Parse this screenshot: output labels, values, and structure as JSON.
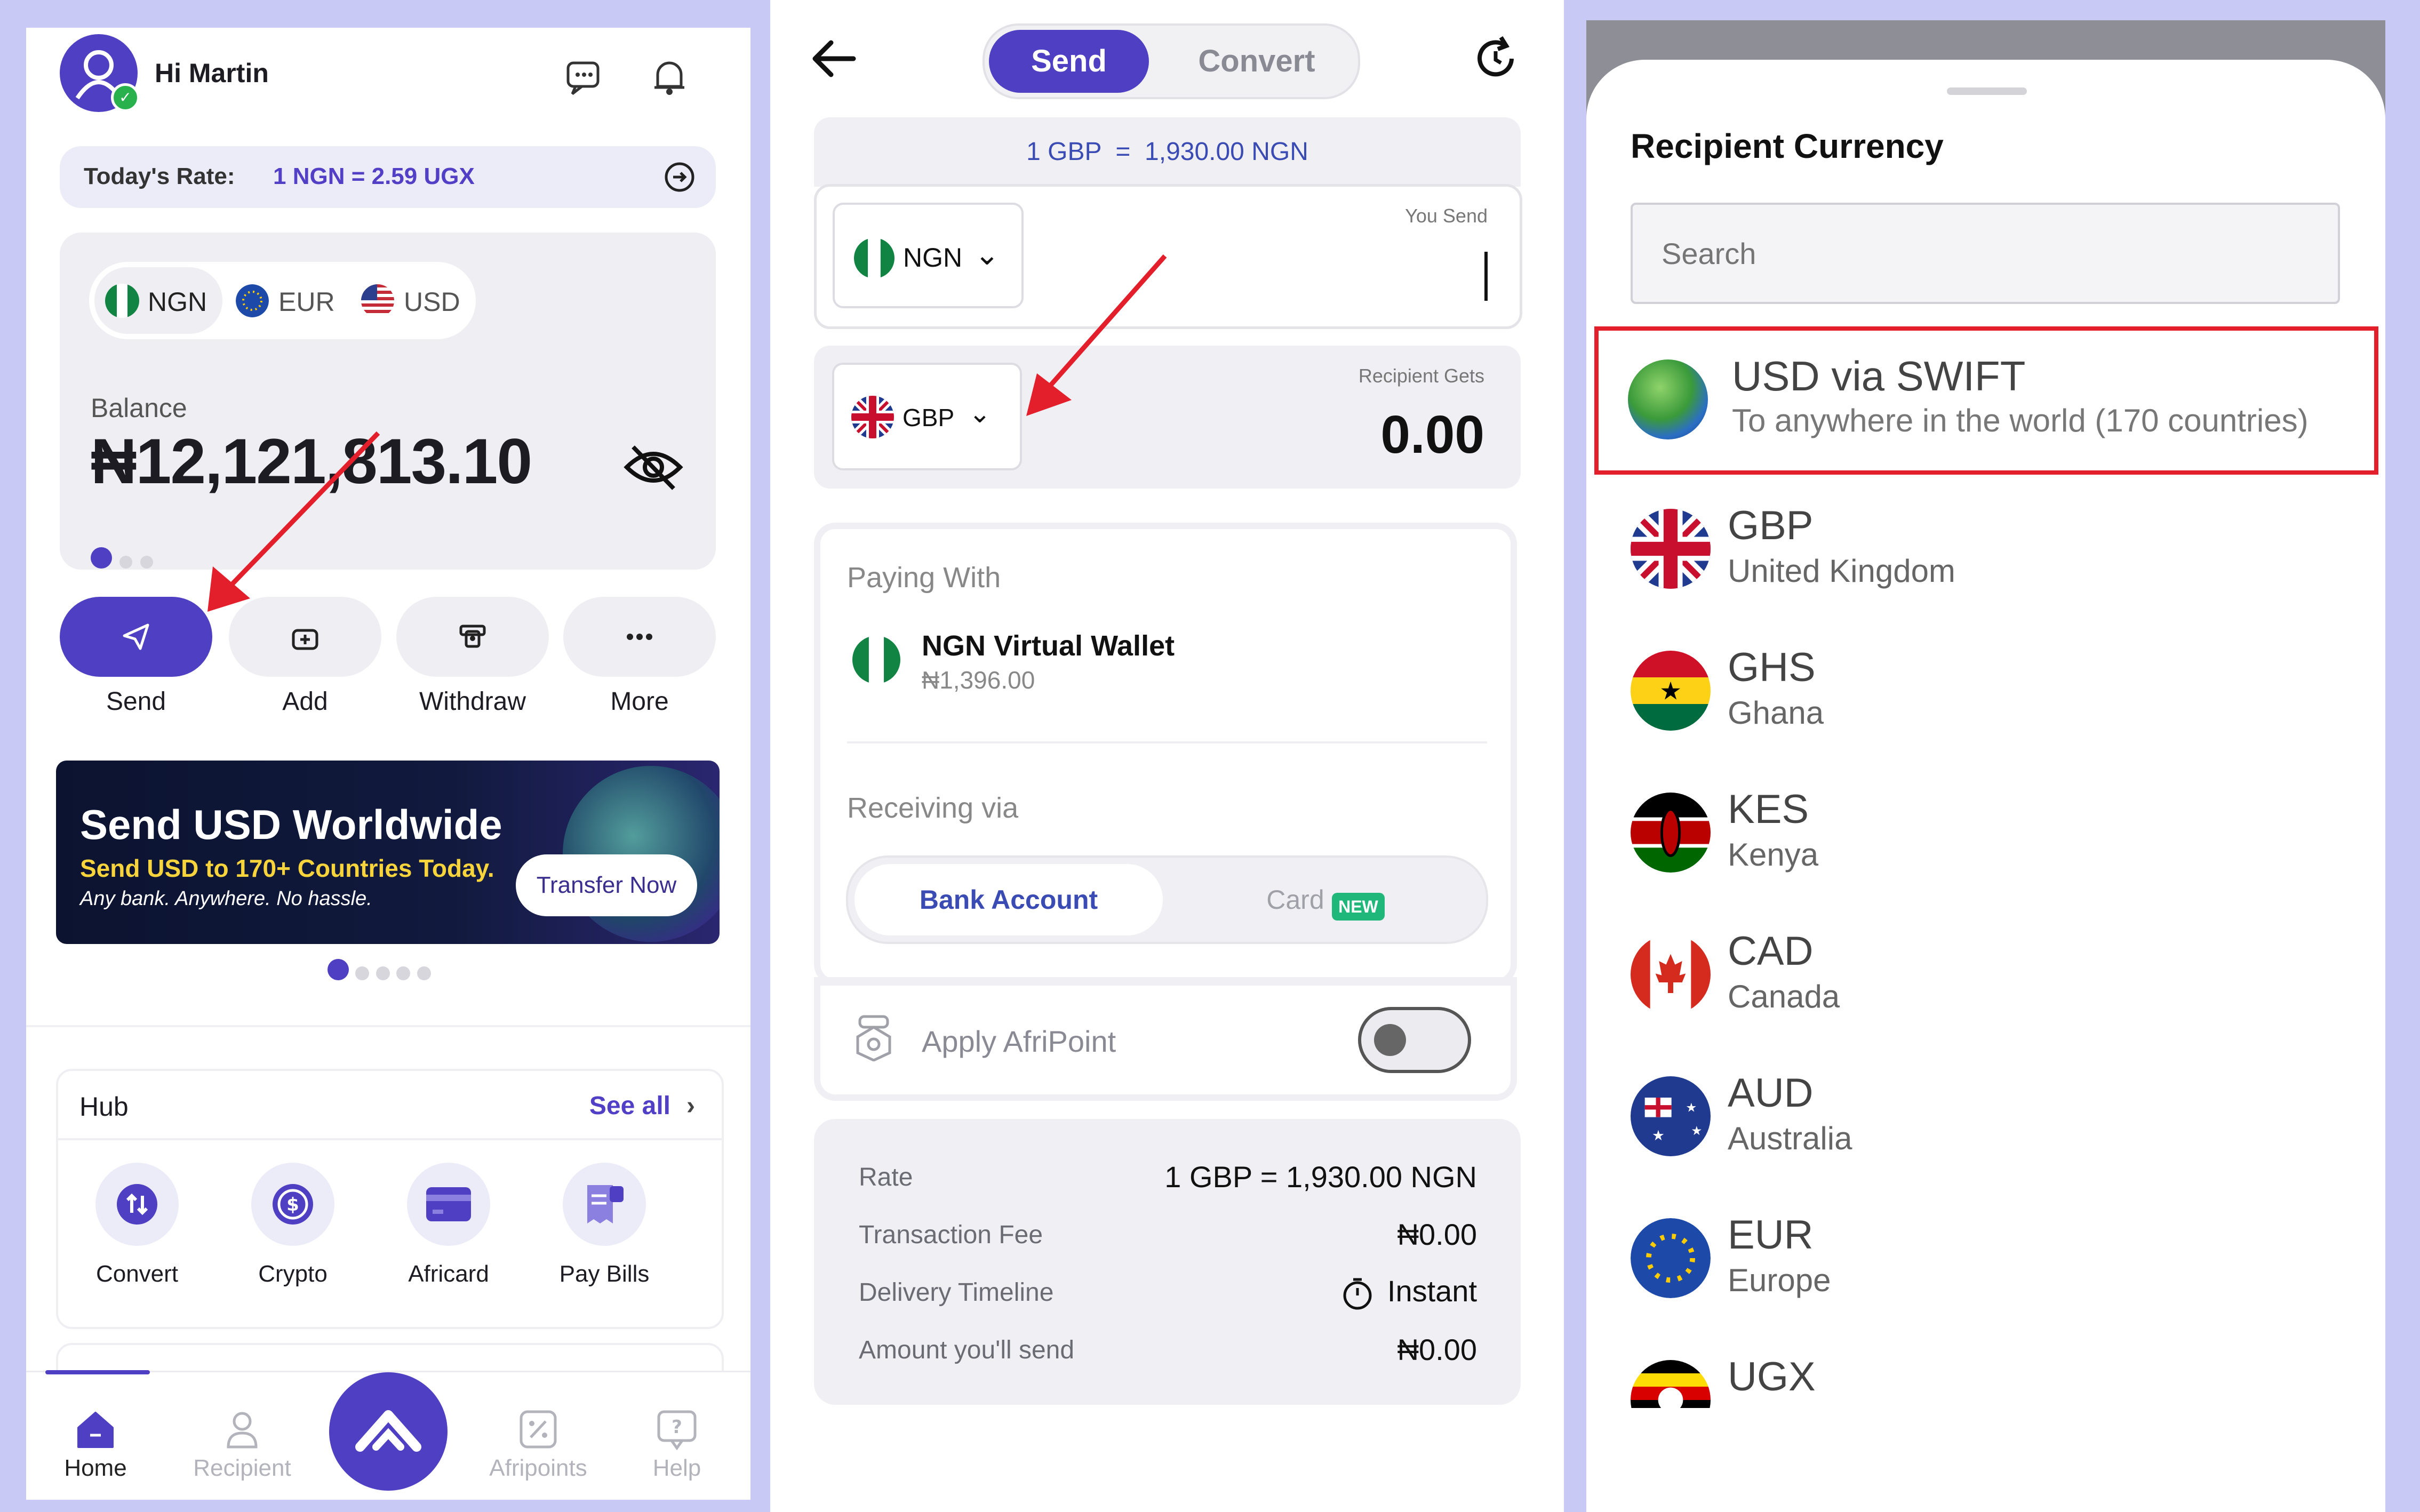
{
  "colors": {
    "accent": "#5140c6",
    "bg": "#c9c9f5",
    "highlight": "#e21f2a",
    "toggle_off": "#e6e6ea",
    "new_badge": "#1fb77a"
  },
  "home": {
    "greeting": "Hi Martin",
    "rate_label": "Today's Rate:",
    "rate_value": "1 NGN = 2.59 UGX",
    "currency_tabs": [
      {
        "code": "NGN",
        "flag": "nigeria"
      },
      {
        "code": "EUR",
        "flag": "eu"
      },
      {
        "code": "USD",
        "flag": "usa"
      }
    ],
    "balance_label": "Balance",
    "balance_value": "₦12,121,813.10",
    "actions": [
      {
        "label": "Send",
        "icon": "paper-plane-icon"
      },
      {
        "label": "Add",
        "icon": "wallet-plus-icon"
      },
      {
        "label": "Withdraw",
        "icon": "cash-withdraw-icon"
      },
      {
        "label": "More",
        "icon": "more-dots-icon"
      }
    ],
    "banner": {
      "title": "Send USD Worldwide",
      "subtitle": "Send USD to 170+ Countries Today.",
      "note": "Any bank. Anywhere. No hassle.",
      "cta": "Transfer Now"
    },
    "hub": {
      "title": "Hub",
      "see_all": "See all",
      "items": [
        {
          "label": "Convert",
          "icon": "convert-arrows-icon"
        },
        {
          "label": "Crypto",
          "icon": "dollar-coin-icon"
        },
        {
          "label": "Africard",
          "icon": "card-icon"
        },
        {
          "label": "Pay Bills",
          "icon": "bill-icon"
        }
      ]
    },
    "nav": [
      {
        "label": "Home",
        "icon": "home-icon"
      },
      {
        "label": "Recipient",
        "icon": "person-icon"
      },
      {
        "label": "",
        "icon": "logo-icon"
      },
      {
        "label": "Afripoints",
        "icon": "percent-icon"
      },
      {
        "label": "Help",
        "icon": "help-bubble-icon"
      }
    ]
  },
  "send": {
    "tabs": [
      "Send",
      "Convert"
    ],
    "rate_banner": "1 GBP  =  1,930.00 NGN",
    "you_send_label": "You Send",
    "from_currency": "NGN",
    "recipient_gets_label": "Recipient Gets",
    "to_currency": "GBP",
    "recipient_amount": "0.00",
    "paying_with_label": "Paying With",
    "wallet_name": "NGN Virtual Wallet",
    "wallet_balance": "₦1,396.00",
    "receiving_via_label": "Receiving via",
    "receive_options": [
      "Bank Account",
      "Card"
    ],
    "new_badge": "NEW",
    "apply_afripoint": "Apply AfriPoint",
    "summary": [
      {
        "label": "Rate",
        "value": "1 GBP = 1,930.00 NGN"
      },
      {
        "label": "Transaction Fee",
        "value": "₦0.00"
      },
      {
        "label": "Delivery Timeline",
        "value": "Instant"
      },
      {
        "label": "Amount you'll send",
        "value": "₦0.00"
      }
    ]
  },
  "currency_sheet": {
    "title": "Recipient Currency",
    "search_placeholder": "Search",
    "items": [
      {
        "code": "USD via SWIFT",
        "name": "To anywhere in the world (170 countries)",
        "flag": "globe"
      },
      {
        "code": "GBP",
        "name": "United Kingdom",
        "flag": "uk"
      },
      {
        "code": "GHS",
        "name": "Ghana",
        "flag": "ghana"
      },
      {
        "code": "KES",
        "name": "Kenya",
        "flag": "kenya"
      },
      {
        "code": "CAD",
        "name": "Canada",
        "flag": "canada"
      },
      {
        "code": "AUD",
        "name": "Australia",
        "flag": "australia"
      },
      {
        "code": "EUR",
        "name": "Europe",
        "flag": "eu"
      },
      {
        "code": "UGX",
        "name": "",
        "flag": "uganda"
      }
    ]
  }
}
